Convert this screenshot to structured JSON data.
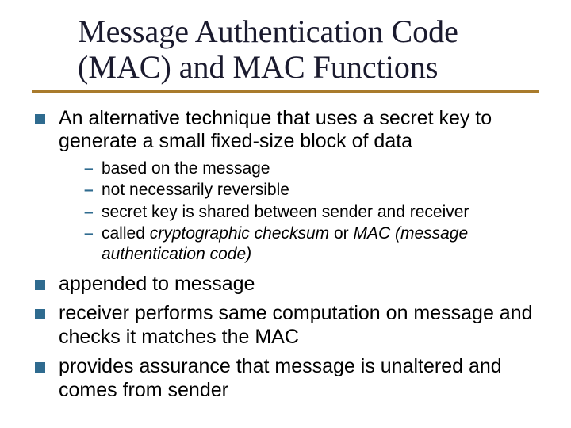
{
  "title_line1": "Message Authentication Code",
  "title_line2": "(MAC) and MAC Functions",
  "bullets": {
    "b1": "An alternative technique that uses a secret key to generate a small fixed-size block of data",
    "sub": {
      "s1": "based on the message",
      "s2": "not necessarily reversible",
      "s3": "secret key is shared between sender and receiver",
      "s4_prefix": "called ",
      "s4_em1": "cryptographic checksum",
      "s4_mid": " or ",
      "s4_em2": "MAC (message authentication code)"
    },
    "b2": "appended to message",
    "b3": "receiver performs same computation on message and checks it matches the MAC",
    "b4": "provides assurance that message is unaltered and comes from sender"
  }
}
